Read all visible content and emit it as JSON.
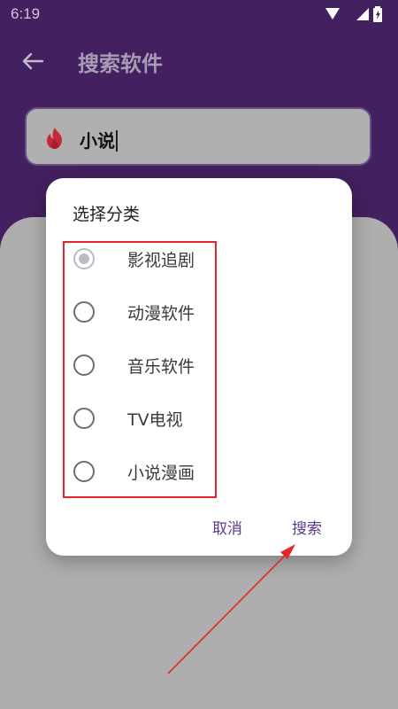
{
  "status_bar": {
    "time": "6:19",
    "icons": [
      "wifi-icon",
      "signal-icon",
      "battery-icon"
    ]
  },
  "app_bar": {
    "back_icon": "arrow-left-icon",
    "title": "搜索软件"
  },
  "search": {
    "icon": "flame-icon",
    "value": "小说"
  },
  "dialog": {
    "title": "选择分类",
    "options": [
      {
        "label": "影视追剧",
        "selected": true
      },
      {
        "label": "动漫软件",
        "selected": false
      },
      {
        "label": "音乐软件",
        "selected": false
      },
      {
        "label": "TV电视",
        "selected": false
      },
      {
        "label": "小说漫画",
        "selected": false
      }
    ],
    "cancel_label": "取消",
    "confirm_label": "搜索"
  },
  "colors": {
    "header_purple": "#43205f",
    "accent": "#5b3a88",
    "highlight_red": "#e3262c"
  }
}
